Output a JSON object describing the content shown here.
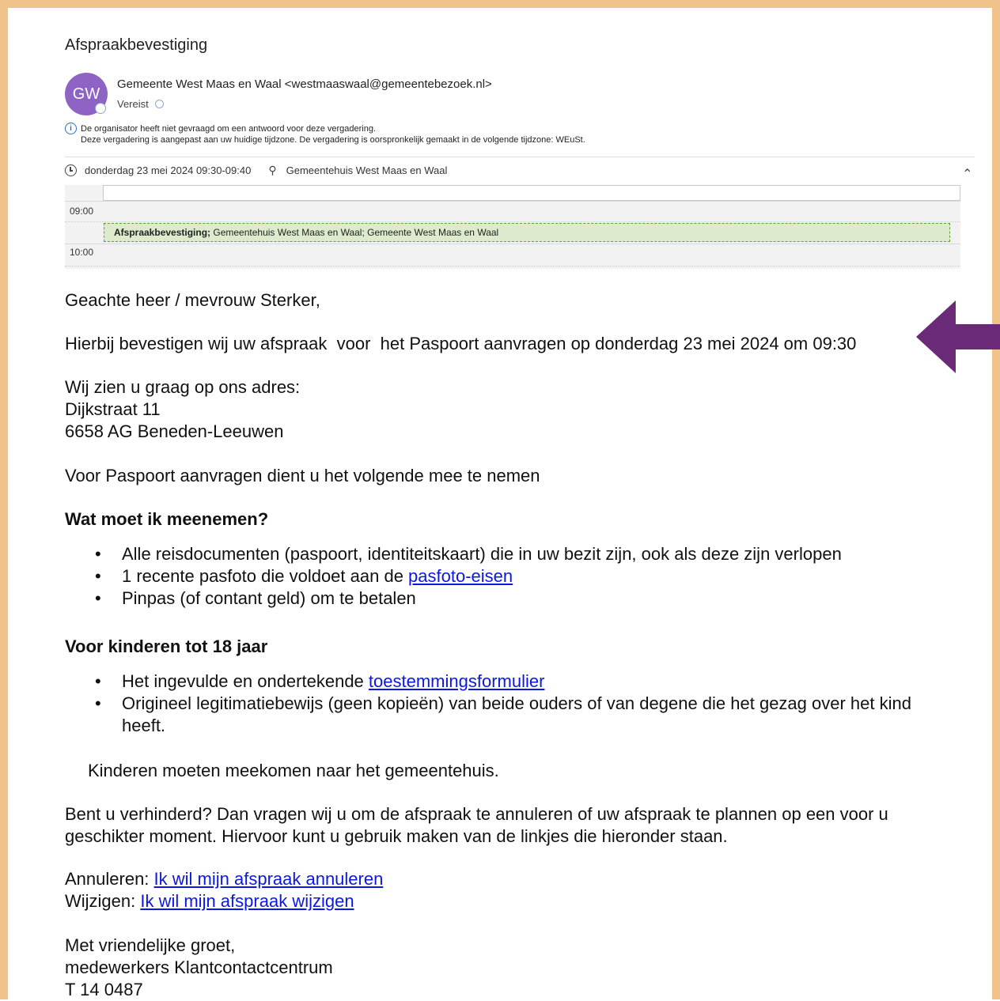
{
  "email": {
    "subject": "Afspraakbevestiging",
    "avatar_initials": "GW",
    "sender": "Gemeente West Maas en Waal <westmaaswaal@gemeentebezoek.nl>",
    "attendance": "Vereist",
    "info_line1": "De organisator heeft niet gevraagd om een antwoord voor deze vergadering.",
    "info_line2": "Deze vergadering is aangepast aan uw huidige tijdzone. De vergadering is oorspronkelijk gemaakt in de volgende tijdzone: WEuSt.",
    "datetime": "donderdag 23 mei 2024 09:30-09:40",
    "location": "Gemeentehuis West Maas en Waal"
  },
  "calendar": {
    "time_0900": "09:00",
    "time_1000": "10:00",
    "event_bold": "Afspraakbevestiging;",
    "event_rest": " Gemeentehuis West Maas en Waal; Gemeente West Maas en Waal",
    "event_color": "#ddebcc"
  },
  "body": {
    "greeting": "Geachte heer / mevrouw Sterker,",
    "confirmation": "Hierbij bevestigen wij uw afspraak  voor  het Paspoort aanvragen op donderdag 23 mei 2024 om 09:30",
    "address_intro": "Wij zien u graag op ons adres:",
    "address_street": "Dijkstraat 11",
    "address_city": "6658 AG Beneden-Leeuwen",
    "bring_intro": "Voor Paspoort aanvragen dient u het volgende mee te nemen",
    "bring_heading": "Wat moet ik meenemen?",
    "bring_item1": "Alle reisdocumenten (paspoort, identiteitskaart) die in uw bezit zijn, ook als deze zijn verlopen",
    "bring_item2_prefix": "1 recente pasfoto die voldoet aan de ",
    "bring_item2_link": "pasfoto-eisen",
    "bring_item3": "Pinpas (of contant geld) om te betalen",
    "kids_heading": "Voor kinderen tot 18 jaar",
    "kids_item1_prefix": "Het ingevulde en ondertekende ",
    "kids_item1_link": "toestemmingsformulier",
    "kids_item2": "Origineel legitimatiebewijs (geen kopieën) van beide ouders of van degene die het gezag over het kind heeft.",
    "kids_note": "Kinderen moeten meekomen naar het gemeentehuis.",
    "cancel_text": "Bent u verhinderd? Dan vragen wij u om de afspraak te annuleren of uw afspraak te plannen op een voor u geschikter moment. Hiervoor kunt u gebruik maken van de linkjes die hieronder staan.",
    "cancel_label": "Annuleren: ",
    "cancel_link": "Ik wil mijn afspraak annuleren",
    "change_label": "Wijzigen: ",
    "change_link": "Ik wil mijn afspraak wijzigen",
    "closing": "Met vriendelijke groet,",
    "team": "medewerkers Klantcontactcentrum",
    "phone": "T 14 0487"
  },
  "annotation": {
    "arrow_color": "#6a2a78",
    "frame_color": "#f0c38a",
    "link_color": "#0b19e0"
  }
}
